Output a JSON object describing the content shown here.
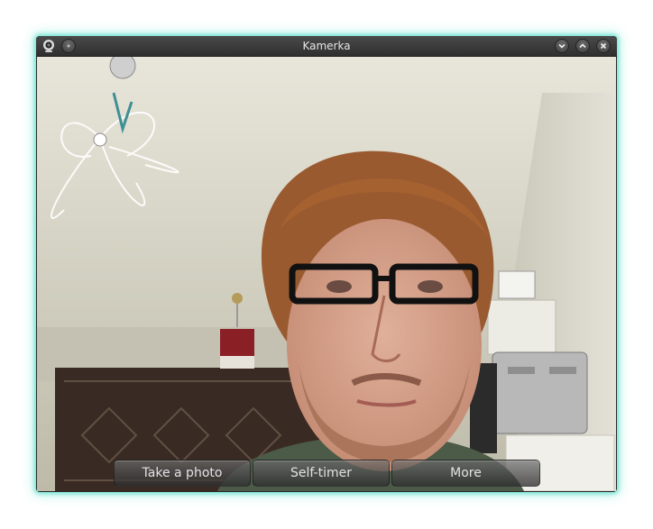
{
  "window": {
    "title": "Kamerka",
    "glow_color": "#5ad9c6"
  },
  "titlebar": {
    "app_icon": "webcam-icon",
    "menu_button_icon": "window-menu-dot-icon",
    "minimize_icon": "chevron-down-icon",
    "maximize_icon": "chevron-up-icon",
    "close_icon": "close-icon"
  },
  "camera_feed": {
    "content": "live webcam preview"
  },
  "controls": {
    "take_photo": "Take a photo",
    "self_timer": "Self-timer",
    "more": "More"
  }
}
